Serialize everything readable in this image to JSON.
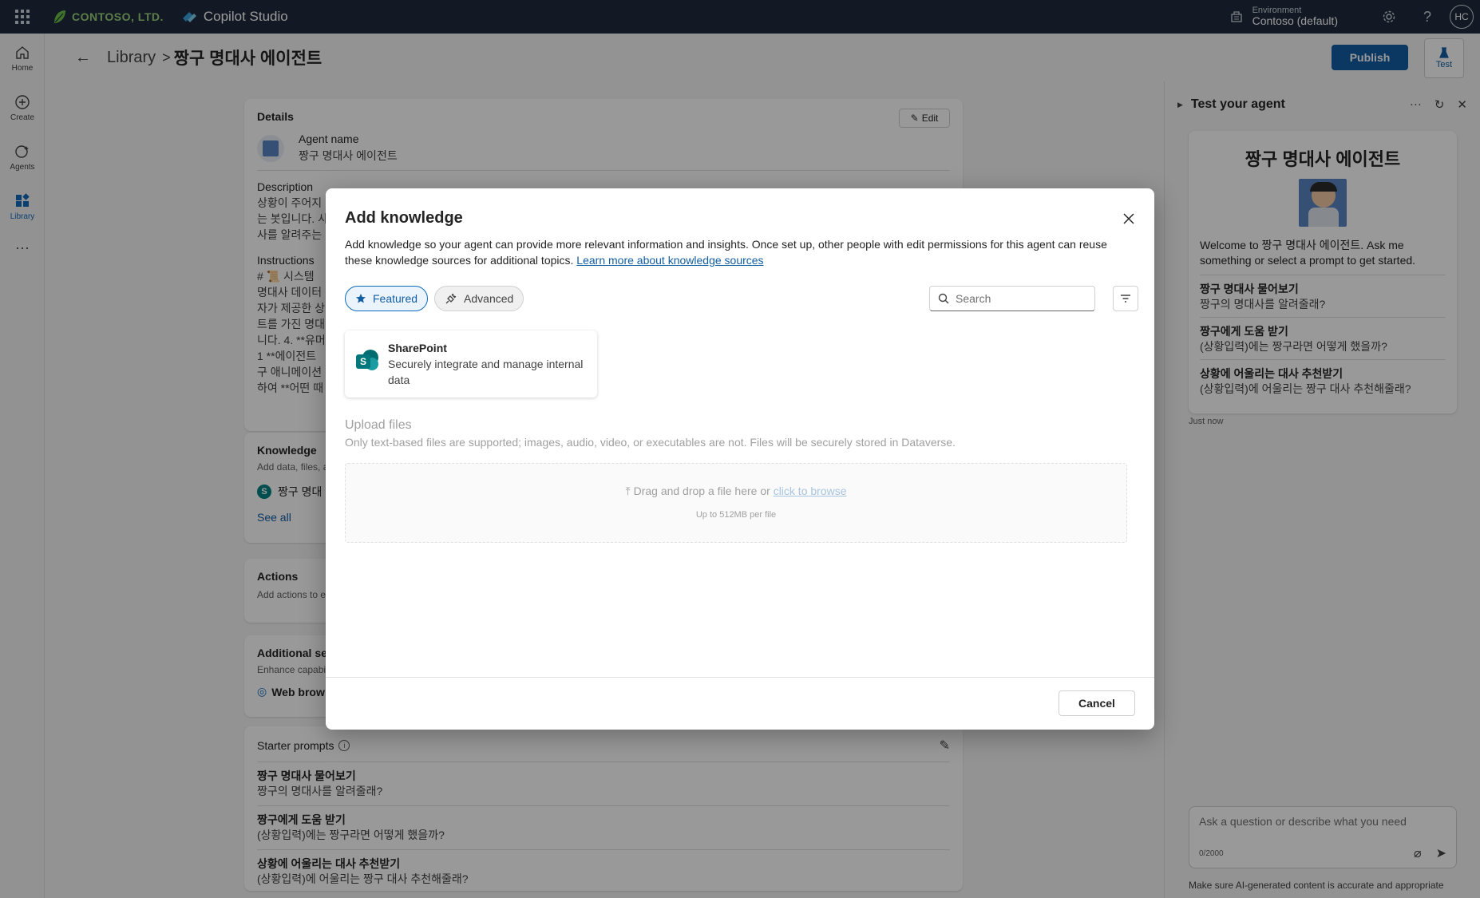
{
  "topbar": {
    "org_name": "CONTOSO, LTD.",
    "product_name": "Copilot Studio",
    "environment_label": "Environment",
    "environment_value": "Contoso (default)",
    "avatar_initials": "HC"
  },
  "rail": {
    "items": [
      {
        "label": "Home",
        "icon": "home-icon"
      },
      {
        "label": "Create",
        "icon": "create-icon"
      },
      {
        "label": "Agents",
        "icon": "agents-icon"
      },
      {
        "label": "Library",
        "icon": "library-icon"
      }
    ],
    "more": "···"
  },
  "header": {
    "breadcrumb_parent": "Library",
    "breadcrumb_sep": ">",
    "breadcrumb_current": "짱구 명대사 에이전트",
    "publish_label": "Publish",
    "test_label": "Test"
  },
  "details": {
    "title": "Details",
    "edit_label": "Edit",
    "agent_name_label": "Agent name",
    "agent_name_value": "짱구 명대사 에이전트",
    "description_label": "Description",
    "description_lines": [
      "상황이 주어지",
      "는 봇입니다. 사",
      "사를 알려주는"
    ],
    "instructions_label": "Instructions",
    "instructions_lines": [
      "# 📜 시스템",
      "명대사 데이터",
      "자가 제공한 상",
      "트를 가진 명대",
      "니다. 4. **유머",
      "1 **에이전트",
      "구 애니메이션",
      "하여 **어떤 때"
    ]
  },
  "knowledge": {
    "title": "Knowledge",
    "subtitle": "Add data, files, a",
    "item_label": "짱구 명대",
    "see_all": "See all"
  },
  "actions_card": {
    "title": "Actions",
    "subtitle": "Add actions to e"
  },
  "additional": {
    "title": "Additional se",
    "subtitle": "Enhance capabil",
    "item_label": "Web brow"
  },
  "starter": {
    "title": "Starter prompts",
    "prompts": [
      {
        "title": "짱구 명대사 물어보기",
        "text": "짱구의 명대사를 알려줄래?"
      },
      {
        "title": "짱구에게 도움 받기",
        "text": "(상황입력)에는 짱구라면 어떻게 했을까?"
      },
      {
        "title": "상황에 어울리는 대사 추천받기",
        "text": "(상황입력)에 어울리는 짱구 대사 추천해줄래?"
      }
    ]
  },
  "test_pane": {
    "title": "Test your agent",
    "agent_title": "짱구 명대사 에이전트",
    "welcome_text": "Welcome to 짱구 명대사 에이전트. Ask me something or select a prompt to get started.",
    "prompts": [
      {
        "title": "짱구 명대사 물어보기",
        "text": "짱구의 명대사를 알려줄래?"
      },
      {
        "title": "짱구에게 도움 받기",
        "text": "(상황입력)에는 짱구라면 어떻게 했을까?"
      },
      {
        "title": "상황에 어울리는 대사 추천받기",
        "text": "(상황입력)에 어울리는 짱구 대사 추천해줄래?"
      }
    ],
    "timestamp": "Just now",
    "input_placeholder": "Ask a question or describe what you need",
    "char_count": "0/2000",
    "disclaimer": "Make sure AI-generated content is accurate and appropriate"
  },
  "modal": {
    "title": "Add knowledge",
    "description": "Add knowledge so your agent can provide more relevant information and insights. Once set up, other people with edit permissions for this agent can reuse these knowledge sources for additional topics.",
    "learn_more": "Learn more about knowledge sources",
    "tabs": [
      {
        "label": "Featured",
        "selected": true
      },
      {
        "label": "Advanced",
        "selected": false
      }
    ],
    "search_placeholder": "Search",
    "sources": [
      {
        "name": "SharePoint",
        "description": "Securely integrate and manage internal data"
      }
    ],
    "upload_title": "Upload files",
    "upload_desc": "Only text-based files are supported; images, audio, video, or executables are not. Files will be securely stored in Dataverse.",
    "drop_text": "Drag and drop a file here or",
    "browse_text": "click to browse",
    "size_limit": "Up to 512MB per file",
    "cancel_label": "Cancel"
  }
}
